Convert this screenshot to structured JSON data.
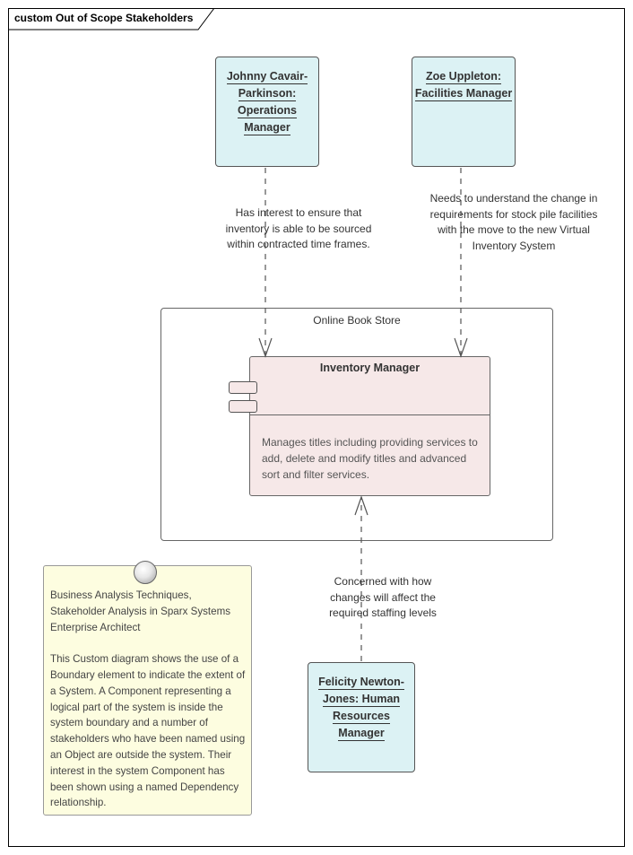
{
  "diagram": {
    "frame_title": "custom Out of Scope Stakeholders"
  },
  "objects": [
    {
      "id": "johnny",
      "name_lines": [
        "Johnny Cavair-",
        "Parkinson:",
        "Operations",
        "Manager"
      ]
    },
    {
      "id": "zoe",
      "name_lines": [
        "Zoe Uppleton:",
        "Facilities Manager"
      ]
    },
    {
      "id": "felicity",
      "name_lines": [
        "Felicity Newton-",
        "Jones: Human",
        "Resources",
        "Manager"
      ]
    }
  ],
  "boundary": {
    "label": "Online Book Store"
  },
  "component": {
    "title": "Inventory Manager",
    "description": "Manages titles including providing services to add, delete and modify titles and advanced sort and filter services."
  },
  "connectors": [
    {
      "from": "Johnny Cavair-Parkinson",
      "to": "Inventory Manager",
      "type": "dependency",
      "label": "Has interest to ensure that inventory is able to be sourced within contracted time frames."
    },
    {
      "from": "Zoe Uppleton",
      "to": "Inventory Manager",
      "type": "dependency",
      "label": "Needs to understand the change in requirements for stock pile facilities with the move to the new Virtual Inventory System"
    },
    {
      "from": "Felicity Newton-Jones",
      "to": "Inventory Manager",
      "type": "dependency",
      "label": "Concerned with how changes will affect the required staffing levels"
    }
  ],
  "note": {
    "text": "Business Analysis Techniques, Stakeholder Analysis in Sparx Systems Enterprise Architect\n\nThis Custom diagram shows the use of a Boundary element to indicate the extent of a System. A Component representing a logical part of the system is inside the system boundary and a number of stakeholders who have been named using an Object are outside the system. Their interest in the system Component has been shown using a named Dependency relationship."
  },
  "colors": {
    "object_fill": "#dcf2f4",
    "component_fill": "#f6e8e8",
    "note_fill": "#fdfde0",
    "line": "#555555"
  }
}
